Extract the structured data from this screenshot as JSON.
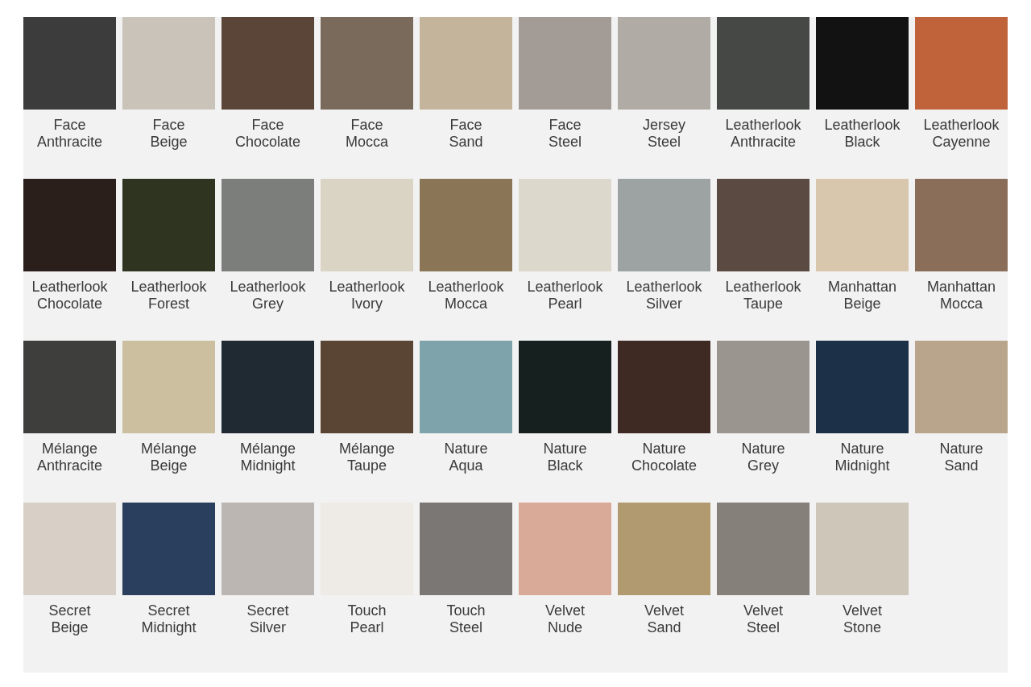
{
  "swatches": [
    {
      "material": "Face",
      "shade": "Anthracite",
      "color": "#3c3c3c"
    },
    {
      "material": "Face",
      "shade": "Beige",
      "color": "#c9c3ba"
    },
    {
      "material": "Face",
      "shade": "Chocolate",
      "color": "#5a4538"
    },
    {
      "material": "Face",
      "shade": "Mocca",
      "color": "#7a6a5c"
    },
    {
      "material": "Face",
      "shade": "Sand",
      "color": "#c4b49c"
    },
    {
      "material": "Face",
      "shade": "Steel",
      "color": "#a39c96"
    },
    {
      "material": "Jersey",
      "shade": "Steel",
      "color": "#b0aba5"
    },
    {
      "material": "Leatherlook",
      "shade": "Anthracite",
      "color": "#454845"
    },
    {
      "material": "Leatherlook",
      "shade": "Black",
      "color": "#121212"
    },
    {
      "material": "Leatherlook",
      "shade": "Cayenne",
      "color": "#c0633a"
    },
    {
      "material": "Leatherlook",
      "shade": "Chocolate",
      "color": "#2b1f1b"
    },
    {
      "material": "Leatherlook",
      "shade": "Forest",
      "color": "#2e3420"
    },
    {
      "material": "Leatherlook",
      "shade": "Grey",
      "color": "#7b7e7b"
    },
    {
      "material": "Leatherlook",
      "shade": "Ivory",
      "color": "#d9d4c4"
    },
    {
      "material": "Leatherlook",
      "shade": "Mocca",
      "color": "#8a7556"
    },
    {
      "material": "Leatherlook",
      "shade": "Pearl",
      "color": "#dcd8cc"
    },
    {
      "material": "Leatherlook",
      "shade": "Silver",
      "color": "#9da2a2"
    },
    {
      "material": "Leatherlook",
      "shade": "Taupe",
      "color": "#5b4a42"
    },
    {
      "material": "Manhattan",
      "shade": "Beige",
      "color": "#d9c7ad"
    },
    {
      "material": "Manhattan",
      "shade": "Mocca",
      "color": "#8a6e5a"
    },
    {
      "material": "Mélange",
      "shade": "Anthracite",
      "color": "#3e3f3d"
    },
    {
      "material": "Mélange",
      "shade": "Beige",
      "color": "#cbbf9f"
    },
    {
      "material": "Mélange",
      "shade": "Midnight",
      "color": "#1f2a33"
    },
    {
      "material": "Mélange",
      "shade": "Taupe",
      "color": "#5a4535"
    },
    {
      "material": "Nature",
      "shade": "Aqua",
      "color": "#7fa3aa"
    },
    {
      "material": "Nature",
      "shade": "Black",
      "color": "#16201e"
    },
    {
      "material": "Nature",
      "shade": "Chocolate",
      "color": "#3e2a22"
    },
    {
      "material": "Nature",
      "shade": "Grey",
      "color": "#9a968f"
    },
    {
      "material": "Nature",
      "shade": "Midnight",
      "color": "#1c3048"
    },
    {
      "material": "Nature",
      "shade": "Sand",
      "color": "#b9a58b"
    },
    {
      "material": "Secret",
      "shade": "Beige",
      "color": "#d8d0c7"
    },
    {
      "material": "Secret",
      "shade": "Midnight",
      "color": "#2a3e5e"
    },
    {
      "material": "Secret",
      "shade": "Silver",
      "color": "#bcb6b2"
    },
    {
      "material": "Touch",
      "shade": "Pearl",
      "color": "#eeebe6"
    },
    {
      "material": "Touch",
      "shade": "Steel",
      "color": "#7a7774"
    },
    {
      "material": "Velvet",
      "shade": "Nude",
      "color": "#d9aa98"
    },
    {
      "material": "Velvet",
      "shade": "Sand",
      "color": "#b19a70"
    },
    {
      "material": "Velvet",
      "shade": "Steel",
      "color": "#858079"
    },
    {
      "material": "Velvet",
      "shade": "Stone",
      "color": "#cdc6b9"
    }
  ]
}
